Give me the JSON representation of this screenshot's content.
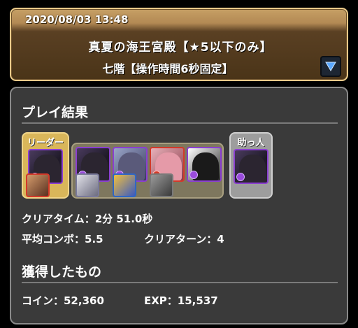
{
  "header": {
    "date": "2020/08/03 13:48",
    "dungeon_title": "真夏の海王宮殿【★5以下のみ】",
    "floor_subtitle": "七階【操作時間6秒固定】"
  },
  "result": {
    "heading": "プレイ結果",
    "leader_label": "リーダー",
    "helper_label": "助っ人",
    "clear_time": "クリアタイム：2分 51.0秒",
    "avg_combo": "平均コンボ：5.5",
    "clear_turns": "クリアターン：4"
  },
  "rewards": {
    "heading": "獲得したもの",
    "coin": "コイン：52,360",
    "exp": "EXP：15,537"
  },
  "colors": {
    "banner_border": "#e9c989",
    "panel_bg": "#3a3a3a",
    "leader_frame": "#d9b65a",
    "helper_frame": "#9d9d9d",
    "dark_attribute": "#8b3fd1",
    "water_attribute": "#3b7be0",
    "fire_attribute": "#d23a2a"
  },
  "icons": {
    "expand": "triangle-down-icon"
  }
}
